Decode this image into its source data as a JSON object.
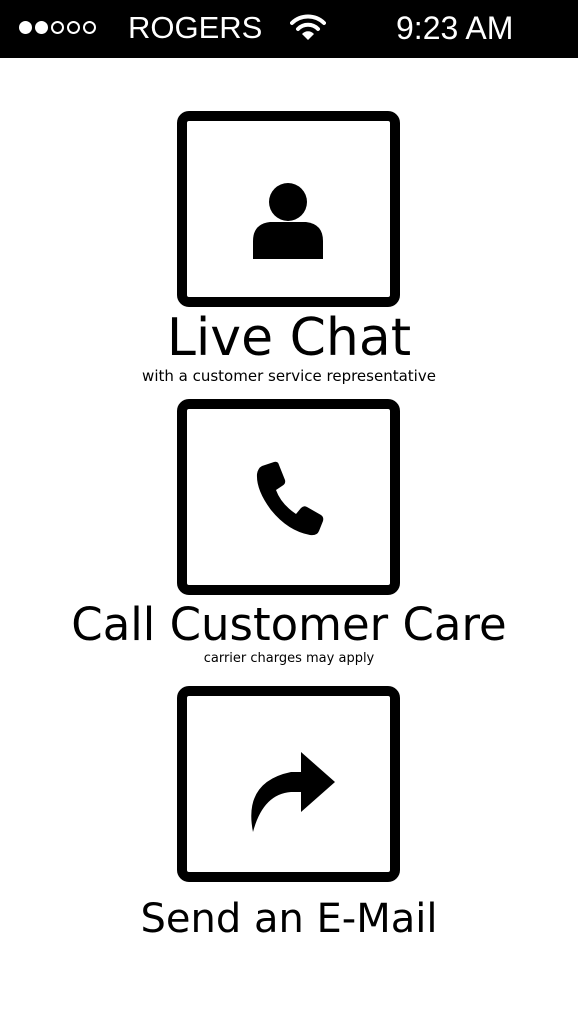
{
  "status_bar": {
    "signal_dots": [
      true,
      true,
      false,
      false,
      false
    ],
    "carrier": "ROGERS",
    "wifi_icon": "wifi-icon",
    "time": "9:23 AM"
  },
  "options": [
    {
      "icon": "person-icon",
      "title": "Live Chat",
      "subtitle": "with a customer service representative"
    },
    {
      "icon": "phone-icon",
      "title": "Call Customer Care",
      "subtitle": "carrier charges may apply"
    },
    {
      "icon": "forward-arrow-icon",
      "title": "Send an E-Mail",
      "subtitle": ""
    }
  ],
  "colors": {
    "status_bar_bg": "#000000",
    "background": "#ffffff",
    "foreground": "#000000"
  }
}
